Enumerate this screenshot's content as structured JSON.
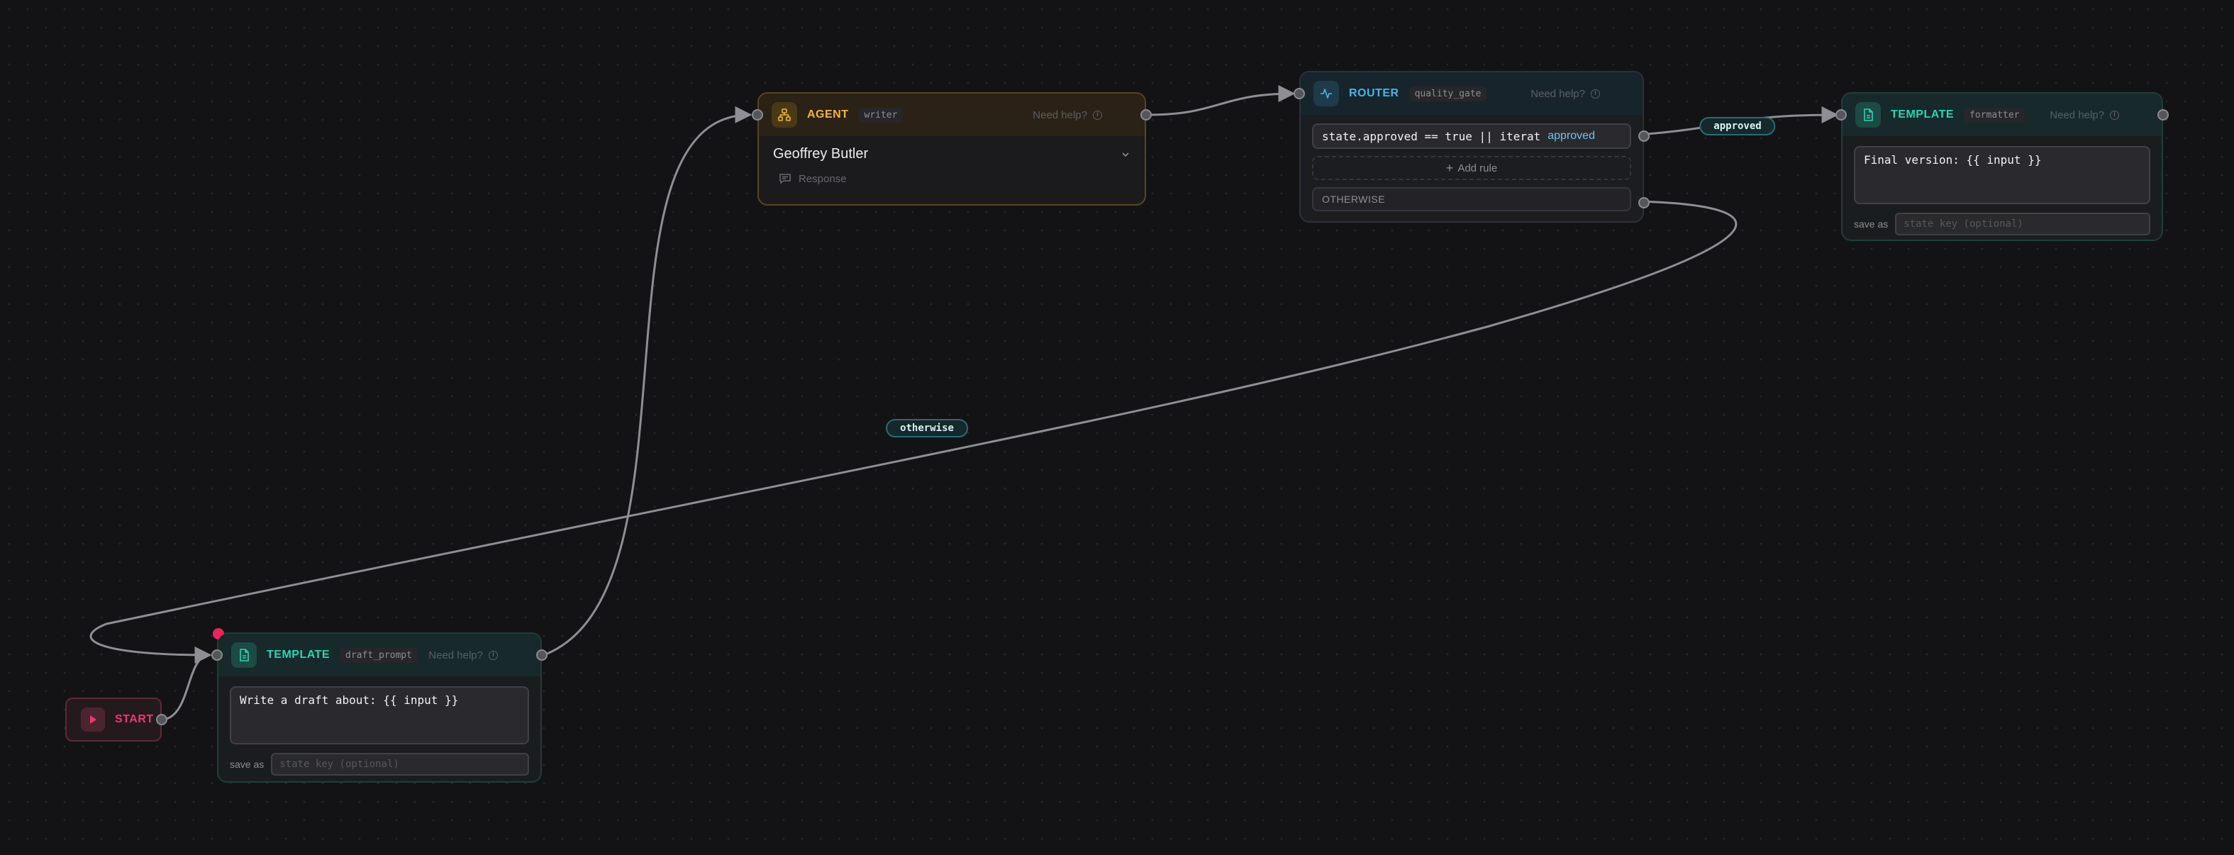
{
  "start": {
    "label": "START",
    "accent": "#f0386b",
    "icon": "play-icon"
  },
  "nodes": {
    "draft_prompt": {
      "type": "TEMPLATE",
      "tag": "draft_prompt",
      "help": "Need help?",
      "template": "Write a draft about: {{ input }}",
      "save_label": "save as",
      "save_placeholder": "state key (optional)",
      "icon": "document-icon",
      "accent": "#2bd4b5"
    },
    "writer": {
      "type": "AGENT",
      "tag": "writer",
      "help": "Need help?",
      "agent_name": "Geoffrey Butler",
      "output_label": "Response",
      "icon": "agent-icon",
      "accent": "#f2b43c"
    },
    "quality_gate": {
      "type": "ROUTER",
      "tag": "quality_gate",
      "help": "Need help?",
      "rules": [
        {
          "condition": "state.approved == true || iterat",
          "target": "approved"
        }
      ],
      "add_rule_label": "Add rule",
      "otherwise_label": "OTHERWISE",
      "icon": "activity-icon",
      "accent": "#4ab4e8"
    },
    "formatter": {
      "type": "TEMPLATE",
      "tag": "formatter",
      "help": "Need help?",
      "template": "Final version: {{ input }}",
      "save_label": "save as",
      "save_placeholder": "state key (optional)",
      "icon": "document-icon",
      "accent": "#2bd4b5"
    }
  },
  "edge_labels": {
    "approved": "approved",
    "otherwise": "otherwise"
  },
  "colors": {
    "edge": "#8e8e94",
    "edge_label_border": "#2b6a74"
  }
}
